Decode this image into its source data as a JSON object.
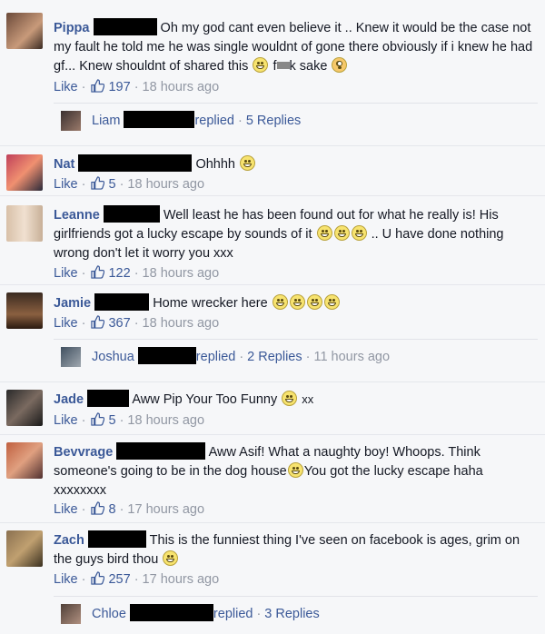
{
  "comments": [
    {
      "author": "Pippa",
      "text": "Oh my god cant even believe it .. Knew it would be the case not my fault he told me he was single wouldnt of gone there obviously if i knew he had gf... Knew shouldnt of shared this",
      "text_tail1": "f",
      "text_tail2": "k sake",
      "like_label": "Like",
      "likes": "197",
      "time": "18 hours ago",
      "reply": {
        "author": "Liam",
        "action": "replied",
        "count": "5 Replies"
      }
    },
    {
      "author": "Nat",
      "text": "Ohhhh",
      "like_label": "Like",
      "likes": "5",
      "time": "18 hours ago"
    },
    {
      "author": "Leanne",
      "text": "Well least he has been found out for what he really is! His girlfriends got a lucky escape by sounds of it",
      "text_tail": ".. U have done nothing wrong don't let it worry you xxx",
      "like_label": "Like",
      "likes": "122",
      "time": "18 hours ago"
    },
    {
      "author": "Jamie",
      "text": "Home wrecker here",
      "like_label": "Like",
      "likes": "367",
      "time": "18 hours ago",
      "reply": {
        "author": "Joshua",
        "action": "replied",
        "count": "2 Replies",
        "time": "11 hours ago"
      }
    },
    {
      "author": "Jade",
      "text": "Aww Pip Your Too Funny",
      "text_tail": "xx",
      "like_label": "Like",
      "likes": "5",
      "time": "18 hours ago"
    },
    {
      "author": "Bevvrage",
      "text": "Aww Asif! What a naughty boy! Whoops. Think someone's going to be in the dog house",
      "text_tail": "You got the lucky escape haha xxxxxxxx",
      "like_label": "Like",
      "likes": "8",
      "time": "17 hours ago"
    },
    {
      "author": "Zach",
      "text": "This is the funniest thing I've seen on facebook is ages, grim on the guys bird thou",
      "like_label": "Like",
      "likes": "257",
      "time": "17 hours ago",
      "reply": {
        "author": "Chloe",
        "action": "replied",
        "count": "3 Replies"
      }
    }
  ],
  "colors": {
    "link": "#3b5998",
    "muted": "#9197a3",
    "background": "#f6f7f9",
    "redaction": "#000000"
  },
  "icons": [
    "thumbs-up-icon",
    "grin-emoji-icon",
    "flushed-emoji-icon"
  ]
}
